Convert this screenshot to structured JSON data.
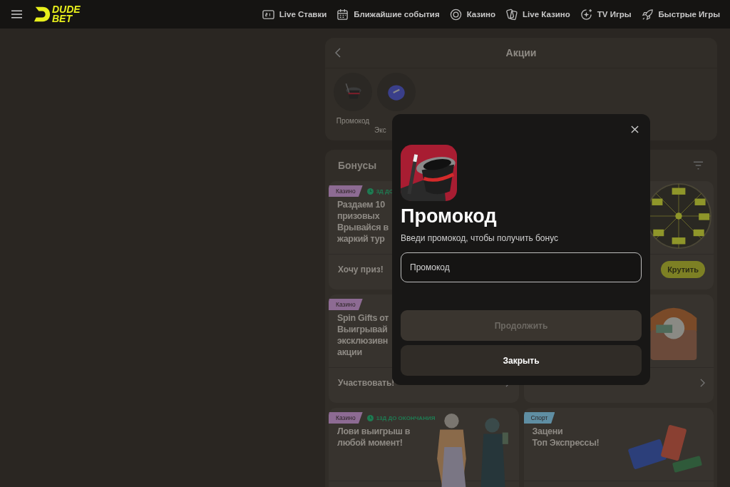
{
  "header": {
    "logo_top": "DUDE",
    "logo_bottom": "BET",
    "nav": [
      {
        "label": "Live Ставки"
      },
      {
        "label": "Ближайшие события"
      },
      {
        "label": "Казино"
      },
      {
        "label": "Live Казино"
      },
      {
        "label": "TV Игры"
      },
      {
        "label": "Быстрые Игры"
      }
    ]
  },
  "promotions": {
    "title": "Акции",
    "stories": [
      {
        "label": "Промокод"
      },
      {
        "label": "Экс"
      }
    ]
  },
  "bonuses": {
    "title": "Бонусы",
    "cards": [
      {
        "tag": {
          "label": "Казино",
          "color": "#8d6b93"
        },
        "timer": "3Д ДО",
        "title": "Раздаем 10\nпризовых\nВрывайся в\nжаркий тур",
        "action": "Хочу приз!",
        "chevron": false
      },
      {
        "button": "Крутить",
        "chevron": false
      },
      {
        "tag": {
          "label": "Казино",
          "color": "#8d6b93"
        },
        "title": "Spin Gifts от\nВыигрывай\nэксклюзивн\nакции",
        "action": "Участвовать!",
        "chevron": true
      },
      {
        "chevron": true
      },
      {
        "tag": {
          "label": "Казино",
          "color": "#8d6b93"
        },
        "timer": "13Д ДО ОКОНЧАНИЯ",
        "title": "Лови выигрыш в\nлюбой момент!",
        "chevron": false
      },
      {
        "tag": {
          "label": "Спорт",
          "color": "#5f8ea3"
        },
        "title": "Зацени\nТоп Экспрессы!",
        "chevron": false
      }
    ]
  },
  "modal": {
    "title": "Промокод",
    "subtitle": "Введи промокод, чтобы получить бонус",
    "input": {
      "placeholder": "Промокод"
    },
    "buttons": [
      {
        "label": "Продолжить",
        "disabled": true
      },
      {
        "label": "Закрыть",
        "disabled": false
      }
    ]
  }
}
